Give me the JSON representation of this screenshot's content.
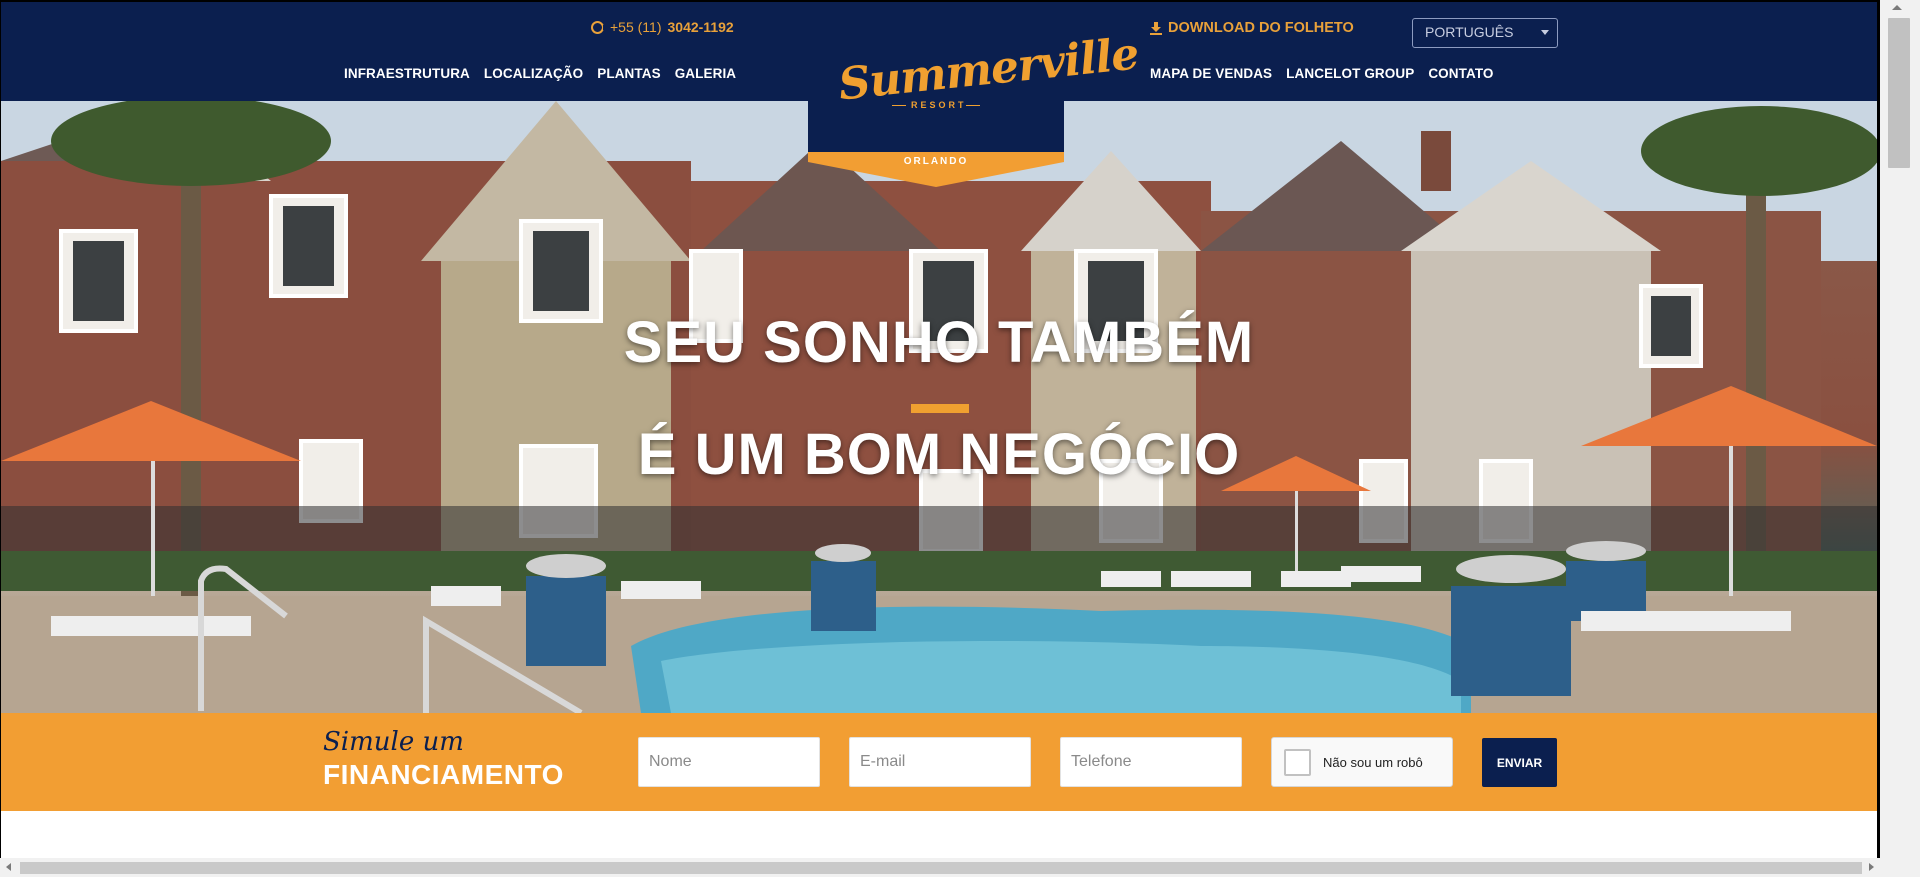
{
  "header": {
    "phone_prefix": "+55 (11)",
    "phone_number": "3042-1192",
    "download_label": "DOWNLOAD DO FOLHETO",
    "language_selected": "PORTUGUÊS",
    "nav_left": [
      "INFRAESTRUTURA",
      "LOCALIZAÇÃO",
      "PLANTAS",
      "GALERIA"
    ],
    "nav_right": [
      "MAPA DE VENDAS",
      "LANCELOT GROUP",
      "CONTATO"
    ]
  },
  "logo": {
    "name": "Summerville",
    "subtitle": "RESORT",
    "city": "ORLANDO"
  },
  "hero": {
    "line1": "SEU SONHO TAMBÉM",
    "line2": "É UM BOM NEGÓCIO"
  },
  "financing": {
    "prefix": "Simule um",
    "title": "FINANCIAMENTO",
    "name_placeholder": "Nome",
    "email_placeholder": "E-mail",
    "phone_placeholder": "Telefone",
    "captcha_label": "Não sou um robô",
    "submit_label": "ENVIAR"
  },
  "colors": {
    "navy": "#0b1f4f",
    "orange": "#f29e33"
  },
  "icons": [
    "phone-icon",
    "download-icon",
    "chevron-down-icon"
  ]
}
